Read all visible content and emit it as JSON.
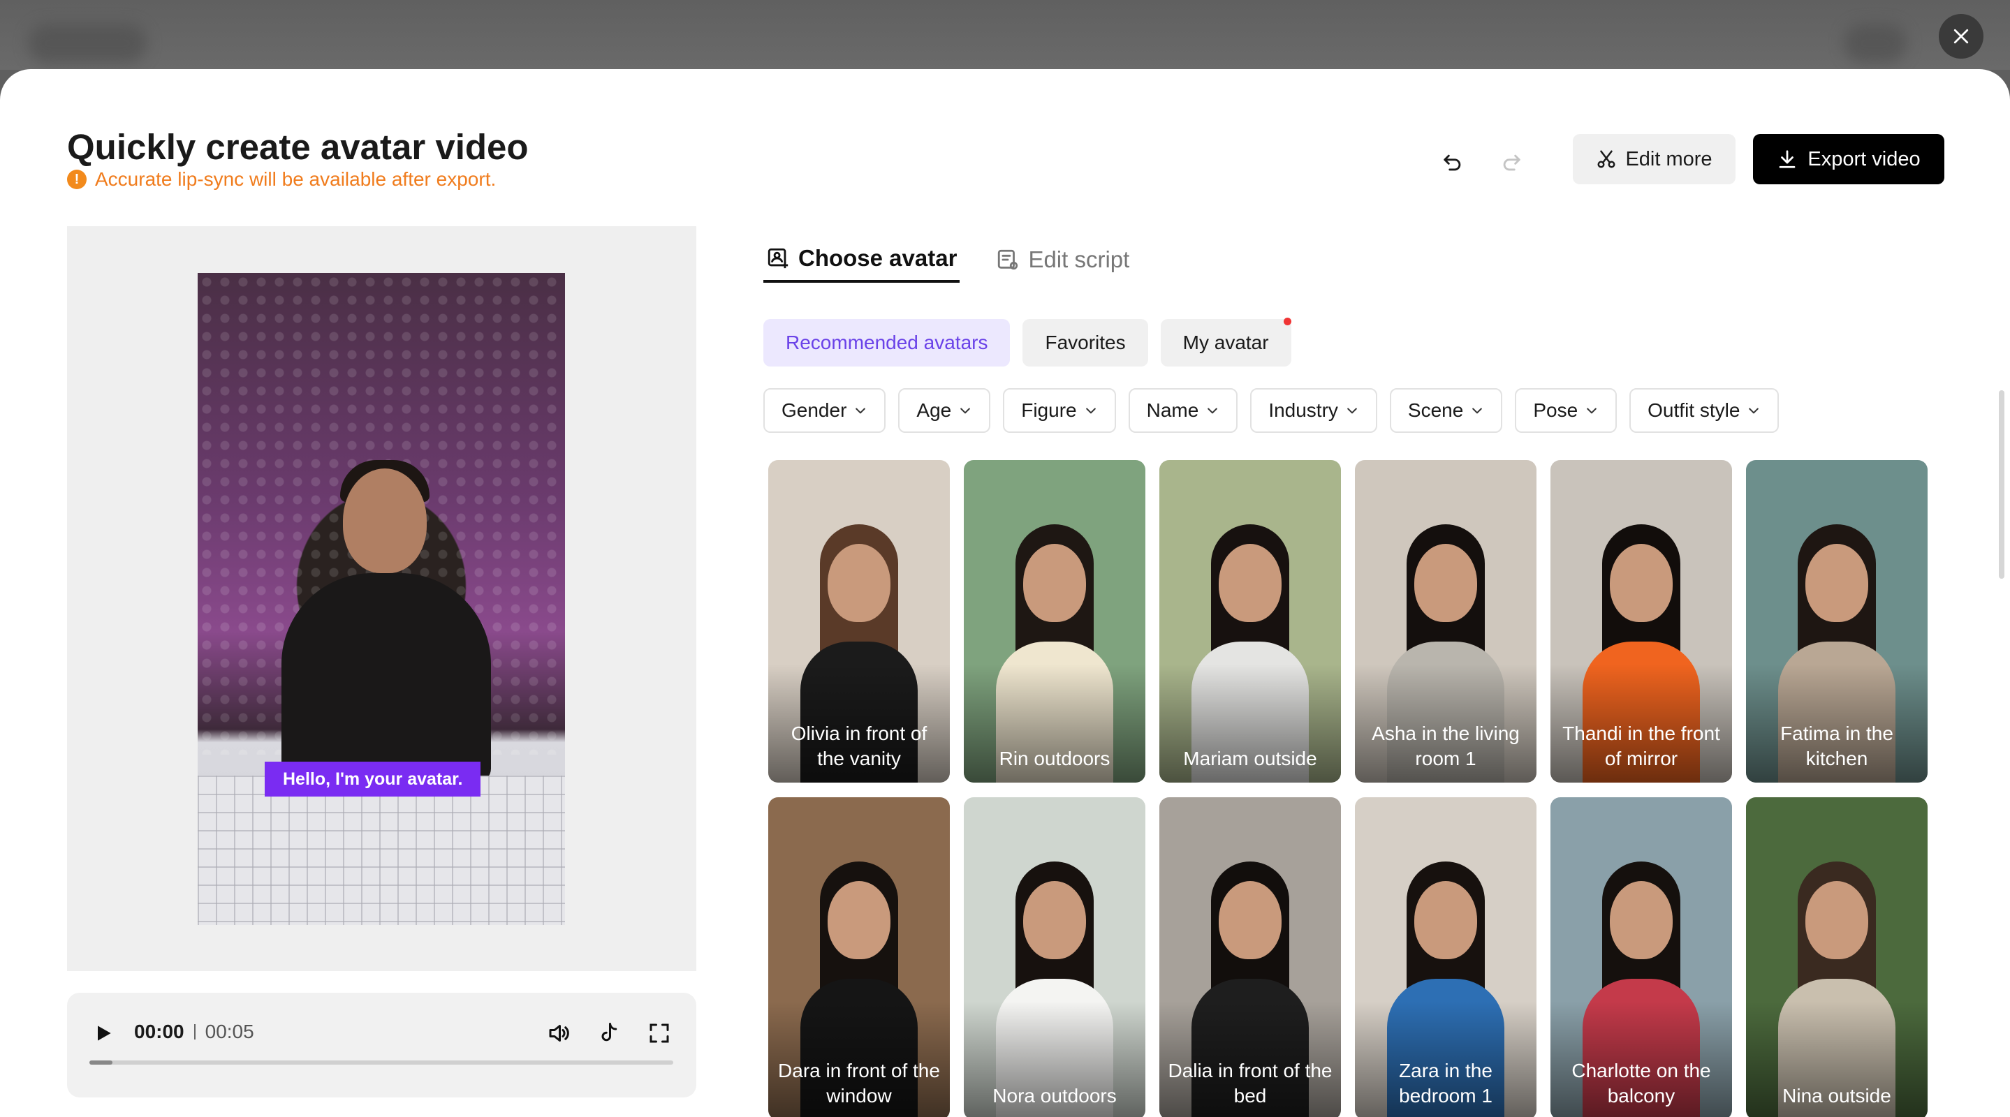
{
  "header": {
    "title": "Quickly create avatar video",
    "notice": "Accurate lip-sync will be available after export.",
    "edit_more_label": "Edit more",
    "export_label": "Export video"
  },
  "preview": {
    "caption": "Hello, I'm your avatar.",
    "current_time": "00:00",
    "duration": "00:05",
    "progress_fraction": 0.04
  },
  "tabs": [
    {
      "label": "Choose avatar",
      "active": true
    },
    {
      "label": "Edit script",
      "active": false
    }
  ],
  "categories": [
    {
      "label": "Recommended avatars",
      "active": true
    },
    {
      "label": "Favorites",
      "active": false
    },
    {
      "label": "My avatar",
      "active": false,
      "has_dot": true
    }
  ],
  "filters": [
    "Gender",
    "Age",
    "Figure",
    "Name",
    "Industry",
    "Scene",
    "Pose",
    "Outfit style"
  ],
  "avatars": [
    {
      "name": "Olivia in front of the vanity",
      "bg": "#d8cfc4",
      "outfit": "#1b1b1b",
      "hair": "#5a3a28"
    },
    {
      "name": "Rin outdoors",
      "bg": "#7fa37e",
      "outfit": "#efe6cf",
      "hair": "#1e1713"
    },
    {
      "name": "Mariam outside",
      "bg": "#a9b58c",
      "outfit": "#e4e4e2",
      "hair": "#17110f"
    },
    {
      "name": "Asha in the living room 1",
      "bg": "#cfc7bd",
      "outfit": "#b9b5ad",
      "hair": "#140f0d"
    },
    {
      "name": "Thandi in the front of mirror",
      "bg": "#c9c3bb",
      "outfit": "#f0641f",
      "hair": "#120d0b"
    },
    {
      "name": "Fatima in the kitchen",
      "bg": "#6d8f8c",
      "outfit": "#b9a794",
      "hair": "#1e1612"
    },
    {
      "name": "Dara in front of the window",
      "bg": "#8b6a4e",
      "outfit": "#151515",
      "hair": "#16110e"
    },
    {
      "name": "Nora outdoors",
      "bg": "#cfd6cf",
      "outfit": "#f4f4f2",
      "hair": "#17110e"
    },
    {
      "name": "Dalia in front of the bed",
      "bg": "#a7a19a",
      "outfit": "#1e1e1e",
      "hair": "#120e0c"
    },
    {
      "name": "Zara in the bedroom 1",
      "bg": "#d6cfc6",
      "outfit": "#2d6fb4",
      "hair": "#17110e"
    },
    {
      "name": "Charlotte on the balcony",
      "bg": "#8aa0a9",
      "outfit": "#c43a4a",
      "hair": "#15100d"
    },
    {
      "name": "Nina outside",
      "bg": "#4c6a3d",
      "outfit": "#c9bfae",
      "hair": "#3a2a20"
    }
  ]
}
